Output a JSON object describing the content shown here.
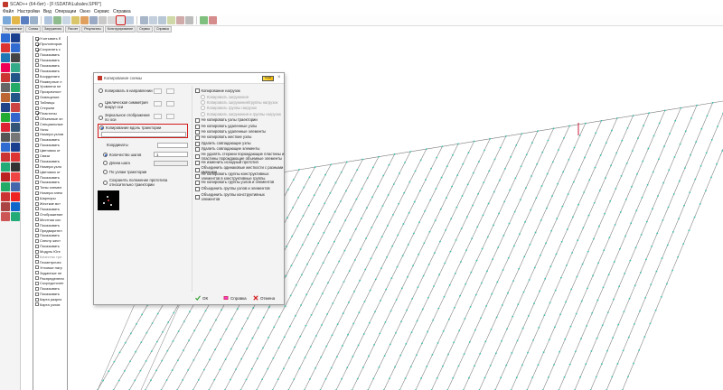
{
  "window": {
    "title": "SCAD++ (64-бит) - [F:\\SDATA\\Lubalev.SPR*]"
  },
  "menu": [
    "Файл",
    "Настройки",
    "Вид",
    "Операции",
    "Окно",
    "Сервис",
    "Справка"
  ],
  "tabs": [
    "Управление",
    "Схема",
    "Загружения",
    "Расчет",
    "Результаты",
    "Конструирование",
    "Сервис",
    "Справка"
  ],
  "tree": {
    "items": [
      {
        "label": "Учитывать б",
        "checked": true
      },
      {
        "label": "Пролонгиров",
        "checked": true
      },
      {
        "label": "Сохранять с",
        "checked": true
      },
      {
        "label": "Показывать",
        "checked": false
      },
      {
        "label": "Показывать",
        "checked": false
      },
      {
        "label": "Показывать",
        "checked": false
      },
      {
        "label": "Показывать",
        "checked": false
      },
      {
        "label": "Координати",
        "checked": false
      },
      {
        "label": "Размерные л",
        "checked": false
      },
      {
        "label": "Уровнени пе",
        "checked": false
      },
      {
        "label": "Прозрачност",
        "checked": false
      },
      {
        "label": "Освещение",
        "checked": false
      },
      {
        "label": "Таблицы",
        "checked": false
      },
      {
        "label": "Стержни",
        "checked": false
      },
      {
        "label": "Пластины",
        "checked": true
      },
      {
        "label": "Объемные эл",
        "checked": false
      },
      {
        "label": "Специальные",
        "checked": false
      },
      {
        "label": "Узлы",
        "checked": false
      },
      {
        "label": "Номера узлов",
        "checked": false
      },
      {
        "label": "Показывать",
        "checked": false
      },
      {
        "label": "Показывать",
        "checked": false
      },
      {
        "label": "Цветовая от",
        "checked": false
      },
      {
        "label": "Связи",
        "checked": false
      },
      {
        "label": "Показывать",
        "checked": false
      },
      {
        "label": "Номера узло",
        "checked": false
      },
      {
        "label": "Цветовая от",
        "checked": false
      },
      {
        "label": "Показывать",
        "checked": false
      },
      {
        "label": "Показывать",
        "checked": false
      },
      {
        "label": "Типы элемен",
        "checked": false
      },
      {
        "label": "Номера элем",
        "checked": false
      },
      {
        "label": "Шарниры",
        "checked": false
      },
      {
        "label": "Жесткие вст",
        "checked": false
      },
      {
        "label": "Показывать",
        "checked": false
      },
      {
        "label": "Отображение",
        "checked": false
      },
      {
        "label": "Местная сис",
        "checked": false
      },
      {
        "label": "Показывать",
        "checked": false
      },
      {
        "label": "Предварител",
        "checked": false
      },
      {
        "label": "Показывать",
        "checked": false
      },
      {
        "label": "Спектр жест",
        "checked": false
      },
      {
        "label": "Показывать",
        "checked": false
      },
      {
        "label": "Модуль Юнг",
        "checked": false
      },
      {
        "label": "Качество тре",
        "checked": false,
        "grey": true
      },
      {
        "label": "Геометричес",
        "checked": false
      },
      {
        "label": "Угловые нагр",
        "checked": false
      },
      {
        "label": "Заданные пе",
        "checked": false
      },
      {
        "label": "Распределени",
        "checked": false
      },
      {
        "label": "Сосредоточен",
        "checked": false
      },
      {
        "label": "Показывать",
        "checked": false
      },
      {
        "label": "Показывать",
        "checked": false
      },
      {
        "label": "Карта разрез",
        "checked": false
      },
      {
        "label": "Карта узлов",
        "checked": false
      }
    ]
  },
  "dialog": {
    "title": "Копирование схемы",
    "close": "×",
    "logo": "SCAD",
    "copy_parallel": "Копировать в направлении",
    "cyclic": "Циклическая симметрия вокруг оси",
    "mirror": "Зеркальное отображение по оси",
    "along_path": "Копирование вдоль траектории",
    "coordinates_label": "Координаты",
    "steps_label": "Количество шагов",
    "steps_value": "1",
    "step_length_label": "Длина шага",
    "by_path_nodes": "По узлам траектории",
    "keep_orientation": "Сохранять положение прототипа относительно траектории",
    "right": {
      "copy_loads": "Копирование нагрузок",
      "copy_loads_sub1": "Копировать загружения",
      "copy_loads_sub2": "Копировать загружения/группы нагрузок",
      "copy_loads_sub3": "Копировать группы нагрузок",
      "copy_loads_sub4": "Копировать загружения и группы нагрузок",
      "opts": [
        "Не копировать узлы траектории",
        "Не копировать удаленные узлы",
        "Не копировать удаленные элементы",
        "Не копировать жесткие узлы",
        "Удалить совпадающие узлы",
        "Удалить совпадающие элементы",
        "Не удалять стержни порождающие пластины и пластины порождающие объемные элементы",
        "Не изменить исходный прототип",
        "Объединить одинаковые жесткости с разными именами",
        "Не копировать группы конструктивных элементов в конструктивные группы",
        "Не копировать группы узлов и элементов",
        "Объединить группы узлов и элементов",
        "Объединить группы конструктивных элементов"
      ]
    },
    "buttons": {
      "ok": "ОК",
      "help": "Справка",
      "cancel": "Отмена"
    }
  },
  "colors": {
    "accent_red": "#d31a1a",
    "grid_line": "#7a7a7a",
    "node_cyan": "#3dbfad",
    "highlight_red": "#c81e3c"
  }
}
